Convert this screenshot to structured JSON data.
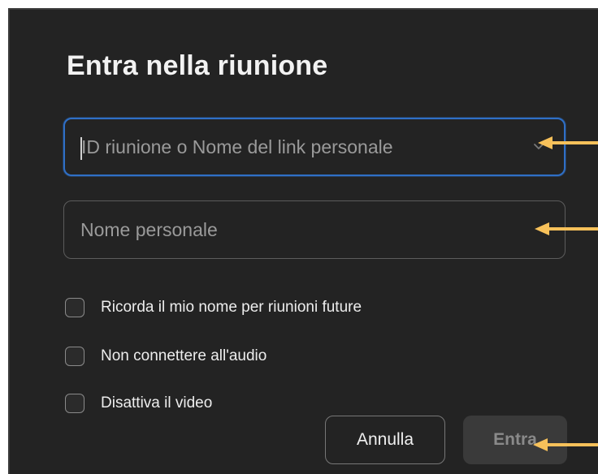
{
  "dialog": {
    "title": "Entra nella riunione"
  },
  "fields": {
    "meeting_id": {
      "placeholder": "ID riunione o Nome del link personale",
      "value": "",
      "dropdown_icon": "chevron-down-icon"
    },
    "name": {
      "placeholder": "Nome personale",
      "value": ""
    }
  },
  "options": [
    {
      "label": "Ricorda il mio nome per riunioni future",
      "checked": false
    },
    {
      "label": "Non connettere all'audio",
      "checked": false
    },
    {
      "label": "Disattiva il video",
      "checked": false
    }
  ],
  "buttons": {
    "cancel": "Annulla",
    "join": "Entra"
  },
  "annotations": {
    "arrow_color": "#f7c15a"
  },
  "colors": {
    "background": "#232323",
    "focus_border": "#2f6fc6",
    "text": "#eeeeee",
    "placeholder": "#9a9a9a"
  }
}
